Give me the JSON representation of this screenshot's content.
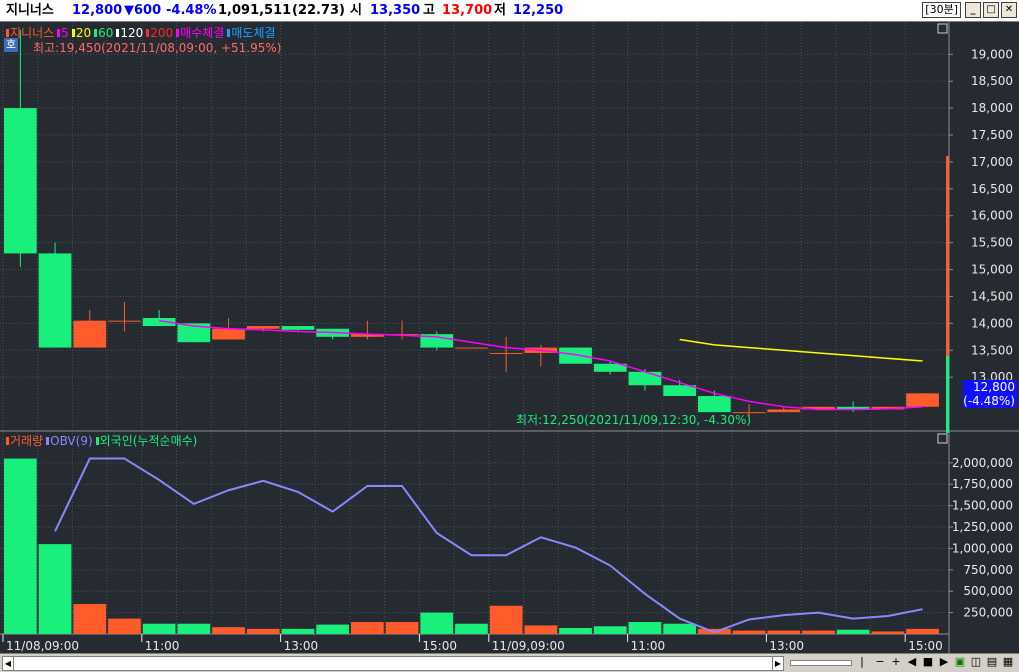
{
  "header": {
    "name": "지니너스",
    "price": "12,800",
    "change": "▼600",
    "change_pct": "-4.48%",
    "volume": "1,091,511",
    "turnover": "(22.73)",
    "open_label": "시",
    "open": "13,350",
    "high_label": "고",
    "high": "13,700",
    "low_label": "저",
    "low": "12,250",
    "period": "[30분]",
    "colors": {
      "up": "#ff5b2b",
      "down": "#19f07c",
      "blue": "#0000ff"
    }
  },
  "price_legend": [
    {
      "label": "지니너스",
      "color": "#ff5b2b"
    },
    {
      "label": "5",
      "color": "#ff00ff"
    },
    {
      "label": "20",
      "color": "#ffff00"
    },
    {
      "label": "60",
      "color": "#19f07c"
    },
    {
      "label": "120",
      "color": "#ffffff"
    },
    {
      "label": "200",
      "color": "#ff2a2a"
    },
    {
      "label": "매수체결",
      "color": "#ff00ff"
    },
    {
      "label": "매도체결",
      "color": "#1ea0ff"
    }
  ],
  "volume_legend": [
    {
      "label": "거래량",
      "color": "#ff5b2b"
    },
    {
      "label": "OBV(9)",
      "color": "#8888ff"
    },
    {
      "label": "외국인(누적순매수)",
      "color": "#19f07c"
    }
  ],
  "annotations": {
    "hoga_badge": "호",
    "high_note": "최고:19,450(2021/11/08,09:00, +51.95%)",
    "low_note": "최저:12,250(2021/11/09,12:30, -4.30%)",
    "current_price": "12,800",
    "current_pct": "(-4.48%)"
  },
  "chart_data": [
    {
      "type": "candlestick",
      "title": "지니너스",
      "yticks": [
        "19,000",
        "18,500",
        "18,000",
        "17,500",
        "17,000",
        "16,500",
        "16,000",
        "15,500",
        "15,000",
        "14,500",
        "14,000",
        "13,500",
        "13,000"
      ],
      "ylim": [
        12000,
        19600
      ],
      "xticks": [
        {
          "index": 0,
          "label": "11/08,09:00"
        },
        {
          "index": 4,
          "label": "11:00"
        },
        {
          "index": 8,
          "label": "13:00"
        },
        {
          "index": 12,
          "label": "15:00"
        },
        {
          "index": 14,
          "label": "11/09,09:00"
        },
        {
          "index": 18,
          "label": "11:00"
        },
        {
          "index": 22,
          "label": "13:00"
        },
        {
          "index": 26,
          "label": "15:00"
        }
      ],
      "candles": [
        {
          "o": 18000,
          "h": 19450,
          "l": 15050,
          "c": 15300
        },
        {
          "o": 15300,
          "h": 15500,
          "l": 13550,
          "c": 13550
        },
        {
          "o": 13550,
          "h": 14250,
          "l": 13550,
          "c": 14050
        },
        {
          "o": 14050,
          "h": 14400,
          "l": 13850,
          "c": 14050
        },
        {
          "o": 14100,
          "h": 14250,
          "l": 13950,
          "c": 13950
        },
        {
          "o": 14000,
          "h": 14000,
          "l": 13650,
          "c": 13650
        },
        {
          "o": 13700,
          "h": 14100,
          "l": 13700,
          "c": 13900
        },
        {
          "o": 13900,
          "h": 13950,
          "l": 13850,
          "c": 13950
        },
        {
          "o": 13950,
          "h": 13950,
          "l": 13850,
          "c": 13880
        },
        {
          "o": 13900,
          "h": 13900,
          "l": 13700,
          "c": 13750
        },
        {
          "o": 13750,
          "h": 14050,
          "l": 13700,
          "c": 13800
        },
        {
          "o": 13800,
          "h": 14050,
          "l": 13700,
          "c": 13800
        },
        {
          "o": 13800,
          "h": 13850,
          "l": 13500,
          "c": 13550
        },
        {
          "o": 13550,
          "h": 13550,
          "l": 13550,
          "c": 13550
        },
        {
          "o": 13450,
          "h": 13750,
          "l": 13100,
          "c": 13450
        },
        {
          "o": 13450,
          "h": 13600,
          "l": 13200,
          "c": 13550
        },
        {
          "o": 13550,
          "h": 13550,
          "l": 13250,
          "c": 13250
        },
        {
          "o": 13250,
          "h": 13300,
          "l": 13050,
          "c": 13100
        },
        {
          "o": 13100,
          "h": 13150,
          "l": 12750,
          "c": 12850
        },
        {
          "o": 12850,
          "h": 12950,
          "l": 12650,
          "c": 12650
        },
        {
          "o": 12650,
          "h": 12750,
          "l": 12350,
          "c": 12350
        },
        {
          "o": 12350,
          "h": 12500,
          "l": 12250,
          "c": 12350
        },
        {
          "o": 12350,
          "h": 12450,
          "l": 12350,
          "c": 12400
        },
        {
          "o": 12400,
          "h": 12450,
          "l": 12400,
          "c": 12450
        },
        {
          "o": 12450,
          "h": 12550,
          "l": 12350,
          "c": 12400
        },
        {
          "o": 12400,
          "h": 12450,
          "l": 12400,
          "c": 12450
        },
        {
          "o": 12450,
          "h": 12700,
          "l": 12450,
          "c": 12700
        }
      ],
      "ma5": [
        null,
        null,
        null,
        null,
        14050,
        13950,
        13900,
        13880,
        13850,
        13830,
        13800,
        13780,
        13750,
        13650,
        13550,
        13500,
        13420,
        13300,
        13100,
        12900,
        12700,
        12550,
        12450,
        12400,
        12400,
        12410,
        12450
      ],
      "ma20": [
        null,
        null,
        null,
        null,
        null,
        null,
        null,
        null,
        null,
        null,
        null,
        null,
        null,
        null,
        null,
        null,
        null,
        null,
        null,
        13700,
        13600,
        13550,
        13500,
        13450,
        13400,
        13350,
        13300
      ]
    },
    {
      "type": "bar",
      "title": "거래량",
      "yticks": [
        "2,000,000",
        "1,750,000",
        "1,500,000",
        "1,250,000",
        "1,000,000",
        "750,000",
        "500,000",
        "250,000"
      ],
      "ylim": [
        0,
        2150000
      ],
      "volume": [
        2050000,
        1050000,
        350000,
        180000,
        120000,
        120000,
        80000,
        60000,
        60000,
        110000,
        140000,
        140000,
        250000,
        120000,
        330000,
        100000,
        70000,
        90000,
        140000,
        120000,
        60000,
        40000,
        40000,
        40000,
        50000,
        30000,
        60000
      ],
      "volume_dir": [
        "down",
        "down",
        "up",
        "up",
        "down",
        "down",
        "up",
        "up",
        "down",
        "down",
        "up",
        "up",
        "down",
        "down",
        "up",
        "up",
        "down",
        "down",
        "down",
        "down",
        "up",
        "up",
        "up",
        "up",
        "down",
        "up",
        "up"
      ],
      "obv": [
        null,
        1200000,
        2050000,
        2050000,
        1800000,
        1520000,
        1680000,
        1790000,
        1660000,
        1430000,
        1730000,
        1730000,
        1180000,
        920000,
        920000,
        1130000,
        1010000,
        800000,
        470000,
        180000,
        20000,
        170000,
        220000,
        250000,
        180000,
        210000,
        290000
      ]
    }
  ]
}
